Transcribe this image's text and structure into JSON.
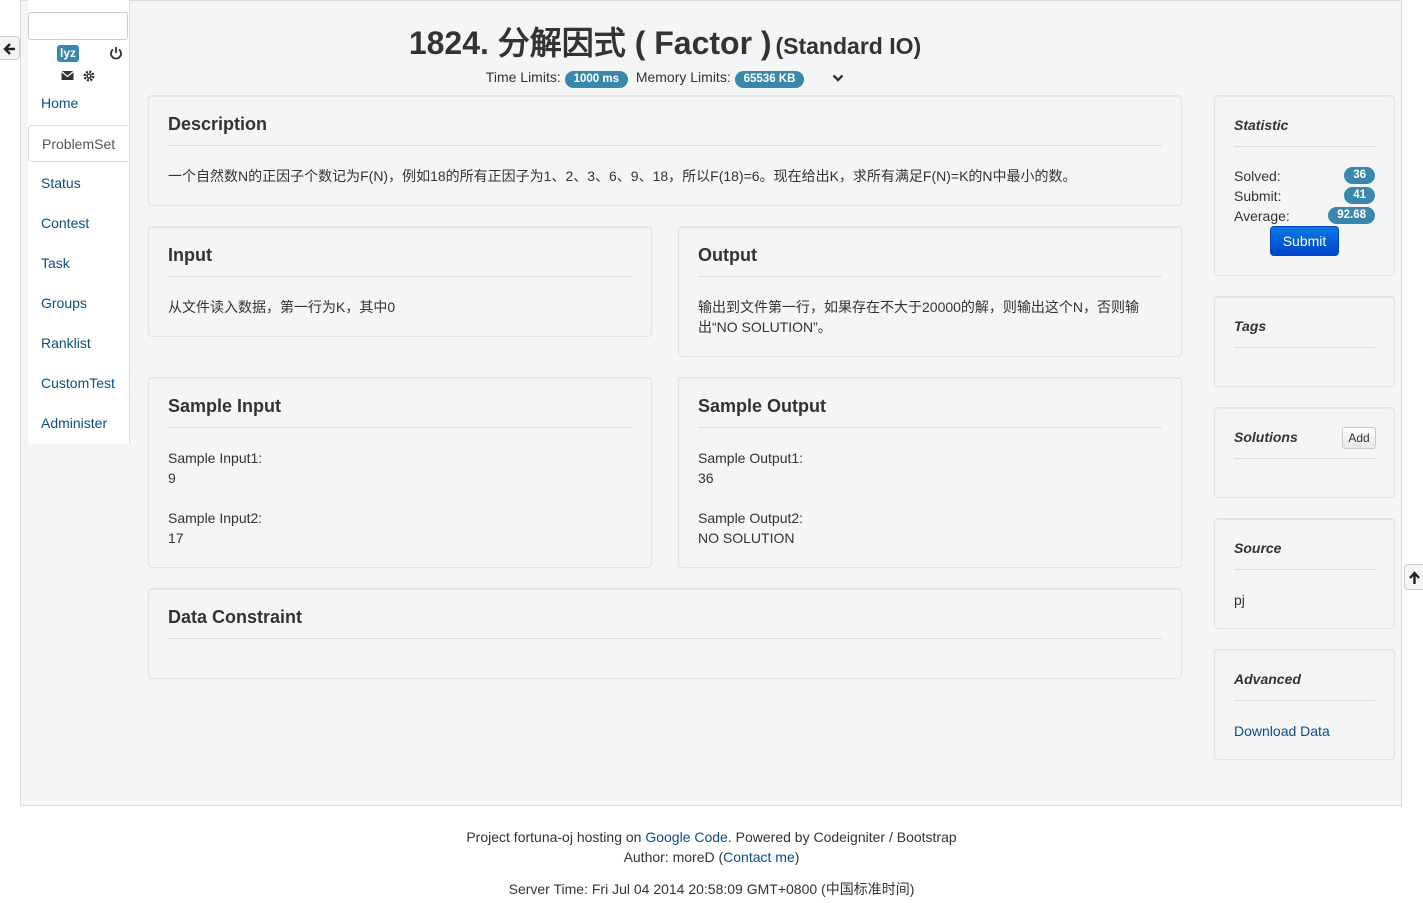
{
  "sidebar": {
    "user": "lyz",
    "items": [
      {
        "label": "Home"
      },
      {
        "label": "ProblemSet"
      },
      {
        "label": "Status"
      },
      {
        "label": "Contest"
      },
      {
        "label": "Task"
      },
      {
        "label": "Groups"
      },
      {
        "label": "Ranklist"
      },
      {
        "label": "CustomTest"
      },
      {
        "label": "Administer"
      }
    ]
  },
  "problem": {
    "title": "1824. 分解因式 ( Factor )",
    "io_type": "(Standard IO)",
    "time_limit_label": "Time Limits:",
    "time_limit": "1000 ms",
    "memory_limit_label": "Memory Limits:",
    "memory_limit": "65536 KB"
  },
  "description": {
    "title": "Description",
    "text": "一个自然数N的正因子个数记为F(N)，例如18的所有正因子为1、2、3、6、9、18，所以F(18)=6。现在给出K，求所有满足F(N)=K的N中最小的数。"
  },
  "input": {
    "title": "Input",
    "text": "从文件读入数据，第一行为K，其中0"
  },
  "output": {
    "title": "Output",
    "text": "输出到文件第一行，如果存在不大于20000的解，则输出这个N，否则输出“NO SOLUTION”。"
  },
  "sample_input": {
    "title": "Sample Input",
    "items": [
      {
        "label": "Sample Input1:",
        "value": "9"
      },
      {
        "label": "Sample Input2:",
        "value": "17"
      }
    ]
  },
  "sample_output": {
    "title": "Sample Output",
    "items": [
      {
        "label": "Sample Output1:",
        "value": "36"
      },
      {
        "label": "Sample Output2:",
        "value": "NO SOLUTION"
      }
    ]
  },
  "data_constraint": {
    "title": "Data Constraint"
  },
  "statistic": {
    "title": "Statistic",
    "solved_label": "Solved:",
    "solved": "36",
    "submit_label": "Submit:",
    "submit": "41",
    "average_label": "Average:",
    "average": "92.68",
    "submit_button": "Submit"
  },
  "tags": {
    "title": "Tags"
  },
  "solutions": {
    "title": "Solutions",
    "add_button": "Add"
  },
  "source": {
    "title": "Source",
    "value": "pj"
  },
  "advanced": {
    "title": "Advanced",
    "download": "Download Data"
  },
  "footer": {
    "line1_pre": "Project fortuna-oj hosting on ",
    "line1_link": "Google Code",
    "line1_post": ". Powered by Codeigniter / Bootstrap",
    "line2_pre": "Author: moreD (",
    "line2_link": "Contact me",
    "line2_post": ")",
    "server_time": "Server Time: Fri Jul 04 2014 20:58:09 GMT+0800 (中国标准时间)"
  }
}
